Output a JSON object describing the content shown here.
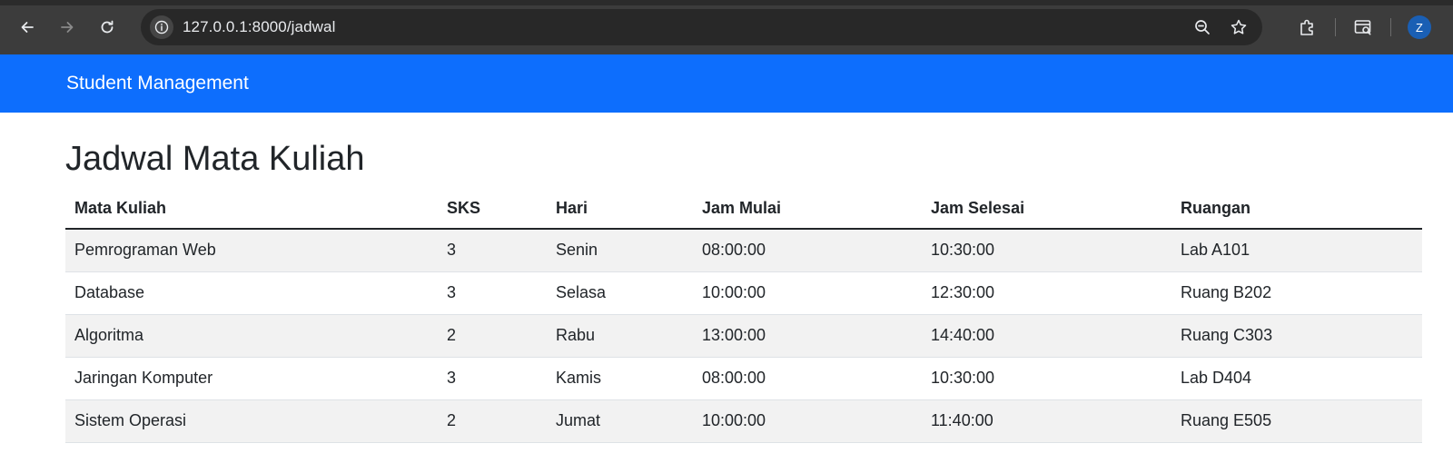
{
  "browser": {
    "url_host": "127.0.0.1",
    "url_path": ":8000/jadwal",
    "profile_initial": "Z"
  },
  "navbar": {
    "brand": "Student Management"
  },
  "page": {
    "title": "Jadwal Mata Kuliah"
  },
  "table": {
    "headers": [
      "Mata Kuliah",
      "SKS",
      "Hari",
      "Jam Mulai",
      "Jam Selesai",
      "Ruangan"
    ],
    "rows": [
      [
        "Pemrograman Web",
        "3",
        "Senin",
        "08:00:00",
        "10:30:00",
        "Lab A101"
      ],
      [
        "Database",
        "3",
        "Selasa",
        "10:00:00",
        "12:30:00",
        "Ruang B202"
      ],
      [
        "Algoritma",
        "2",
        "Rabu",
        "13:00:00",
        "14:40:00",
        "Ruang C303"
      ],
      [
        "Jaringan Komputer",
        "3",
        "Kamis",
        "08:00:00",
        "10:30:00",
        "Lab D404"
      ],
      [
        "Sistem Operasi",
        "2",
        "Jumat",
        "10:00:00",
        "11:40:00",
        "Ruang E505"
      ]
    ]
  },
  "colors": {
    "navbar": "#0d6efd",
    "stripe": "#f2f2f2",
    "chrome": "#3c3c3c"
  }
}
